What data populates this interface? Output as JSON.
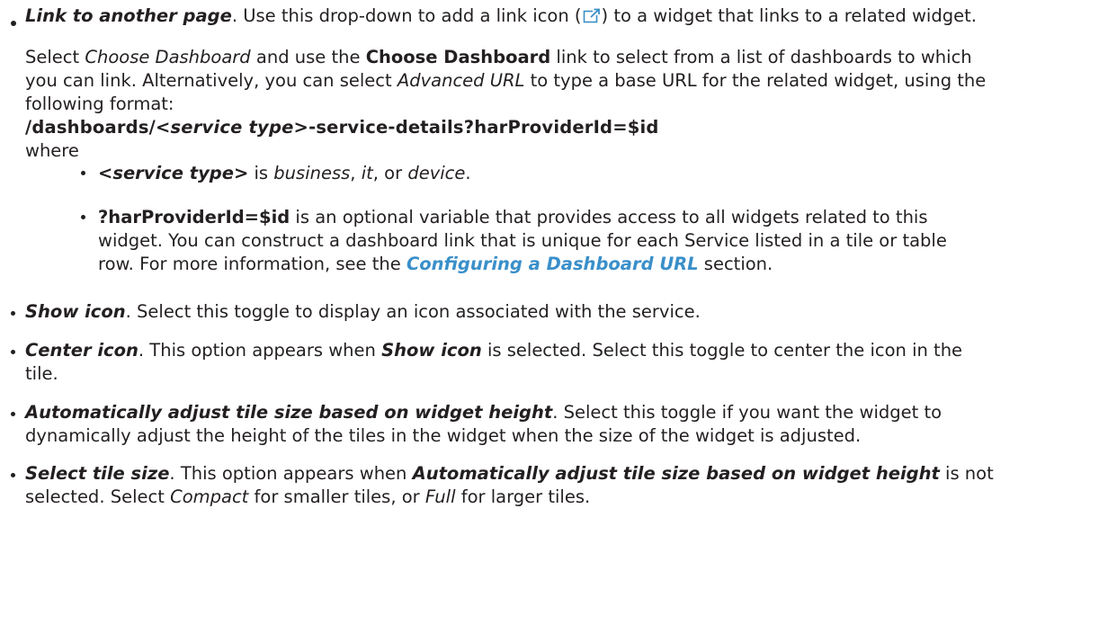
{
  "link_item": {
    "term": "Link to another page",
    "desc_before_icon": ". Use this drop-down to add a link icon (",
    "desc_after_icon": ") to a widget that links to a related widget.",
    "icon": "external-link-icon",
    "icon_color": "#3a8fc9"
  },
  "choose_para": {
    "line1_a": "Select ",
    "line1_b": "Choose Dashboard",
    "line1_c": " and use the ",
    "line1_d": "Choose Dashboard",
    "line1_e": " link to select from a list of dashboards to which",
    "line2_a": "you can link. Alternatively, you can select ",
    "line2_b": "Advanced URL",
    "line2_c": " to type a base URL for the related widget, using the",
    "line3": "following format:"
  },
  "url_format": {
    "prefix": "/dashboards/",
    "placeholder": "<service type>",
    "suffix": "-service-details?harProviderId=$id"
  },
  "where_label": "where",
  "where_items": [
    {
      "term": "<service type>",
      "text_a": " is ",
      "opt1": "business",
      "sep1": ", ",
      "opt2": "it",
      "sep2": ", or ",
      "opt3": "device",
      "end": "."
    },
    {
      "term": "?harProviderId=$id",
      "line1": " is an optional variable that provides access to all widgets related to this",
      "line2": "widget. You can construct a dashboard link that is unique for each Service listed in a tile or table",
      "line3_a": "row. For more information, see the ",
      "line3_link": "Configuring a Dashboard URL",
      "line3_b": " section."
    }
  ],
  "options": [
    {
      "term": "Show icon",
      "line1": ". Select this toggle to display an icon associated with the service."
    },
    {
      "term": "Center icon",
      "line1_a": ". This option appears when ",
      "line1_term": "Show icon",
      "line1_b": " is selected. Select this toggle to center the icon in the",
      "line2": "tile."
    },
    {
      "term": "Automatically adjust tile size based on widget height",
      "line1": ". Select this toggle if you want the widget to",
      "line2": "dynamically adjust the height of the tiles in the widget when the size of the widget is adjusted."
    },
    {
      "term": "Select tile size",
      "line1_a": ". This option appears when ",
      "line1_term": "Automatically adjust tile size based on widget height",
      "line1_b": " is not",
      "line2_a": "selected. Select ",
      "line2_b": "Compact",
      "line2_c": " for smaller tiles, or ",
      "line2_d": "Full",
      "line2_e": " for larger tiles."
    }
  ]
}
